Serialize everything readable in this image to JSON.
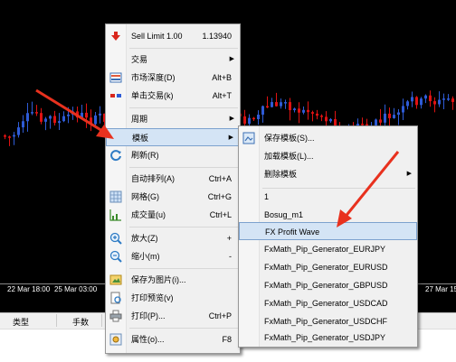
{
  "chart": {
    "time_labels": [
      "22 Mar 18:00",
      "25 Mar 03:00",
      "27 Mar 15"
    ],
    "colors": {
      "bull": "#2e5bd6",
      "bear": "#e01212",
      "background": "#000000"
    }
  },
  "main_menu": {
    "sell_limit_label": "Sell Limit 1.00",
    "sell_limit_price": "1.13940",
    "trade_label": "交易",
    "market_depth_label": "市场深度(D)",
    "market_depth_shortcut": "Alt+B",
    "one_click_label": "单击交易(k)",
    "one_click_shortcut": "Alt+T",
    "period_label": "周期",
    "template_label": "模板",
    "refresh_label": "刷新(R)",
    "autoscroll_label": "自动排列(A)",
    "autoscroll_shortcut": "Ctrl+A",
    "grid_label": "网格(G)",
    "grid_shortcut": "Ctrl+G",
    "volumes_label": "成交量(u)",
    "volumes_shortcut": "Ctrl+L",
    "zoom_in_label": "放大(Z)",
    "zoom_in_shortcut": "+",
    "zoom_out_label": "缩小(m)",
    "zoom_out_shortcut": "-",
    "save_picture_label": "保存为图片(i)...",
    "print_preview_label": "打印预览(v)",
    "print_label": "打印(P)...",
    "print_shortcut": "Ctrl+P",
    "properties_label": "属性(o)...",
    "properties_shortcut": "F8"
  },
  "template_submenu": {
    "save_label": "保存模板(S)...",
    "load_label": "加载模板(L)...",
    "delete_label": "删除模板",
    "items": [
      "1",
      "Bosug_m1",
      "FX Profit Wave",
      "FxMath_Pip_Generator_EURJPY",
      "FxMath_Pip_Generator_EURUSD",
      "FxMath_Pip_Generator_GBPUSD",
      "FxMath_Pip_Generator_USDCAD",
      "FxMath_Pip_Generator_USDCHF",
      "FxMath_Pip_Generator_USDJPY"
    ]
  },
  "bottom_panel": {
    "type_header": "类型",
    "lots_header": "手数"
  }
}
